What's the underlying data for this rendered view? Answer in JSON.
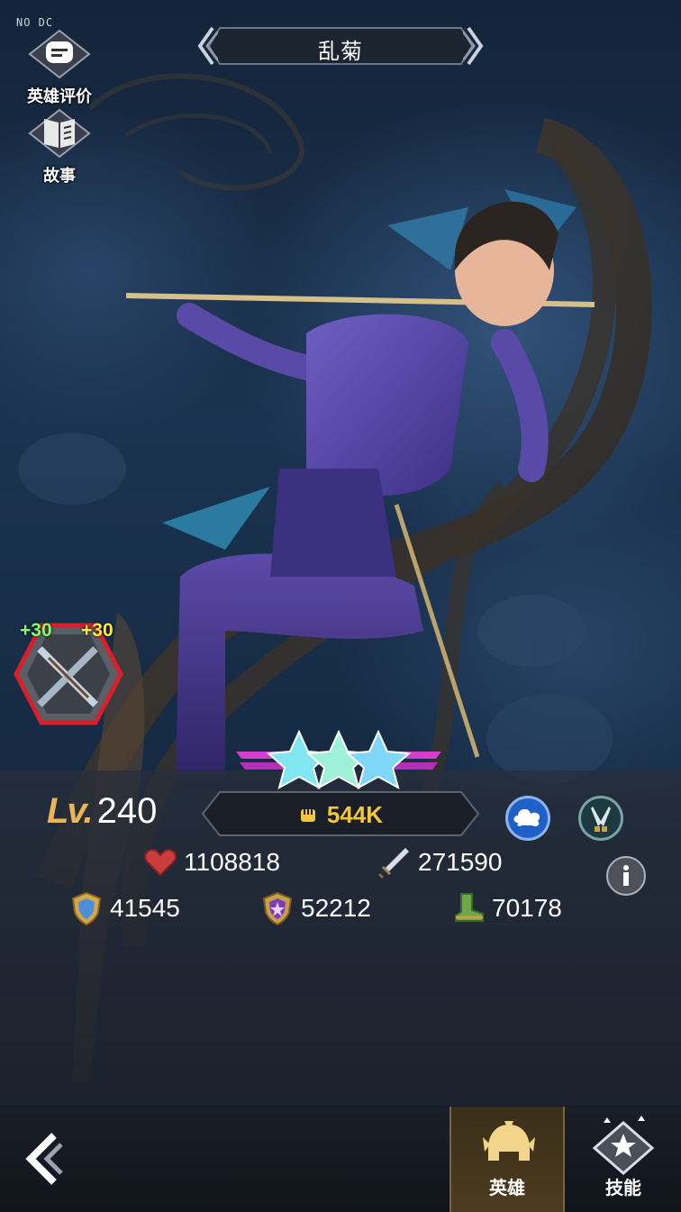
{
  "debug_text": "NO DC",
  "header": {
    "title": "乱菊",
    "prev_label": "《",
    "next_label": "》"
  },
  "side_menu": {
    "review_label": "英雄评价",
    "story_label": "故事"
  },
  "weapon": {
    "icon": "crossed-spears-icon",
    "bonus_left": "+30",
    "bonus_right": "+30"
  },
  "hero": {
    "star_count": 3,
    "level_prefix": "Lv.",
    "level": "240",
    "power": "544K",
    "skill_icons": [
      "cloud-icon",
      "crossed-daggers-icon"
    ],
    "info_icon": "info-icon"
  },
  "stats": {
    "hp": "1108818",
    "attack": "271590",
    "defense": "41545",
    "magic_defense": "52212",
    "speed": "70178"
  },
  "bottom_nav": {
    "back_icon": "back-arrow-icon",
    "tabs": [
      {
        "label": "英雄",
        "icon": "helmet-icon",
        "active": true
      },
      {
        "label": "技能",
        "icon": "skill-badge-icon",
        "active": false
      }
    ]
  },
  "colors": {
    "power_text": "#f3c63a",
    "level_prefix": "#e9b45a",
    "active_tab": "#4a3a1c",
    "bonus_green": "#7dff6a",
    "bonus_yellow": "#ffe93a"
  }
}
